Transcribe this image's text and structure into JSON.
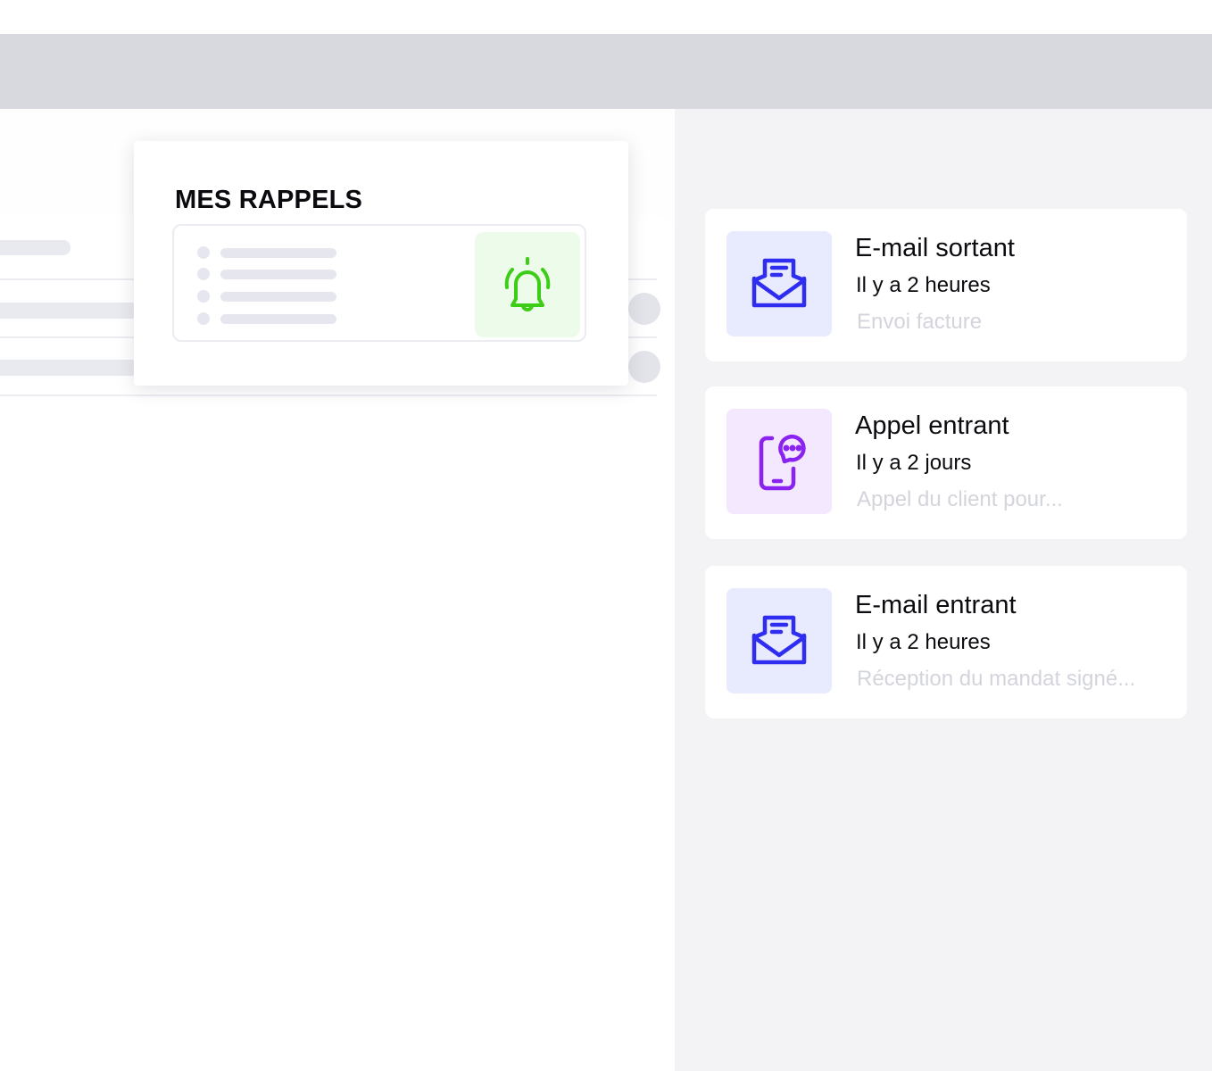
{
  "reminders": {
    "title": "MES RAPPELS",
    "icon": "bell-icon",
    "accent_color": "#3ccd16",
    "tile_color": "#edfbea"
  },
  "activities": [
    {
      "title": "E-mail sortant",
      "time": "Il y a 2 heures",
      "description": "Envoi facture",
      "icon": "envelope-open-icon",
      "icon_color": "#2f2ef0",
      "tile_color": "#e8eafe"
    },
    {
      "title": "Appel entrant",
      "time": "Il y a 2 jours",
      "description": "Appel du client pour...",
      "icon": "phone-chat-icon",
      "icon_color": "#8a22f0",
      "tile_color": "#f3e8fe"
    },
    {
      "title": "E-mail entrant",
      "time": "Il y a 2 heures",
      "description": "Réception du mandat signé...",
      "icon": "envelope-open-icon",
      "icon_color": "#2f2ef0",
      "tile_color": "#e8eafe"
    }
  ]
}
